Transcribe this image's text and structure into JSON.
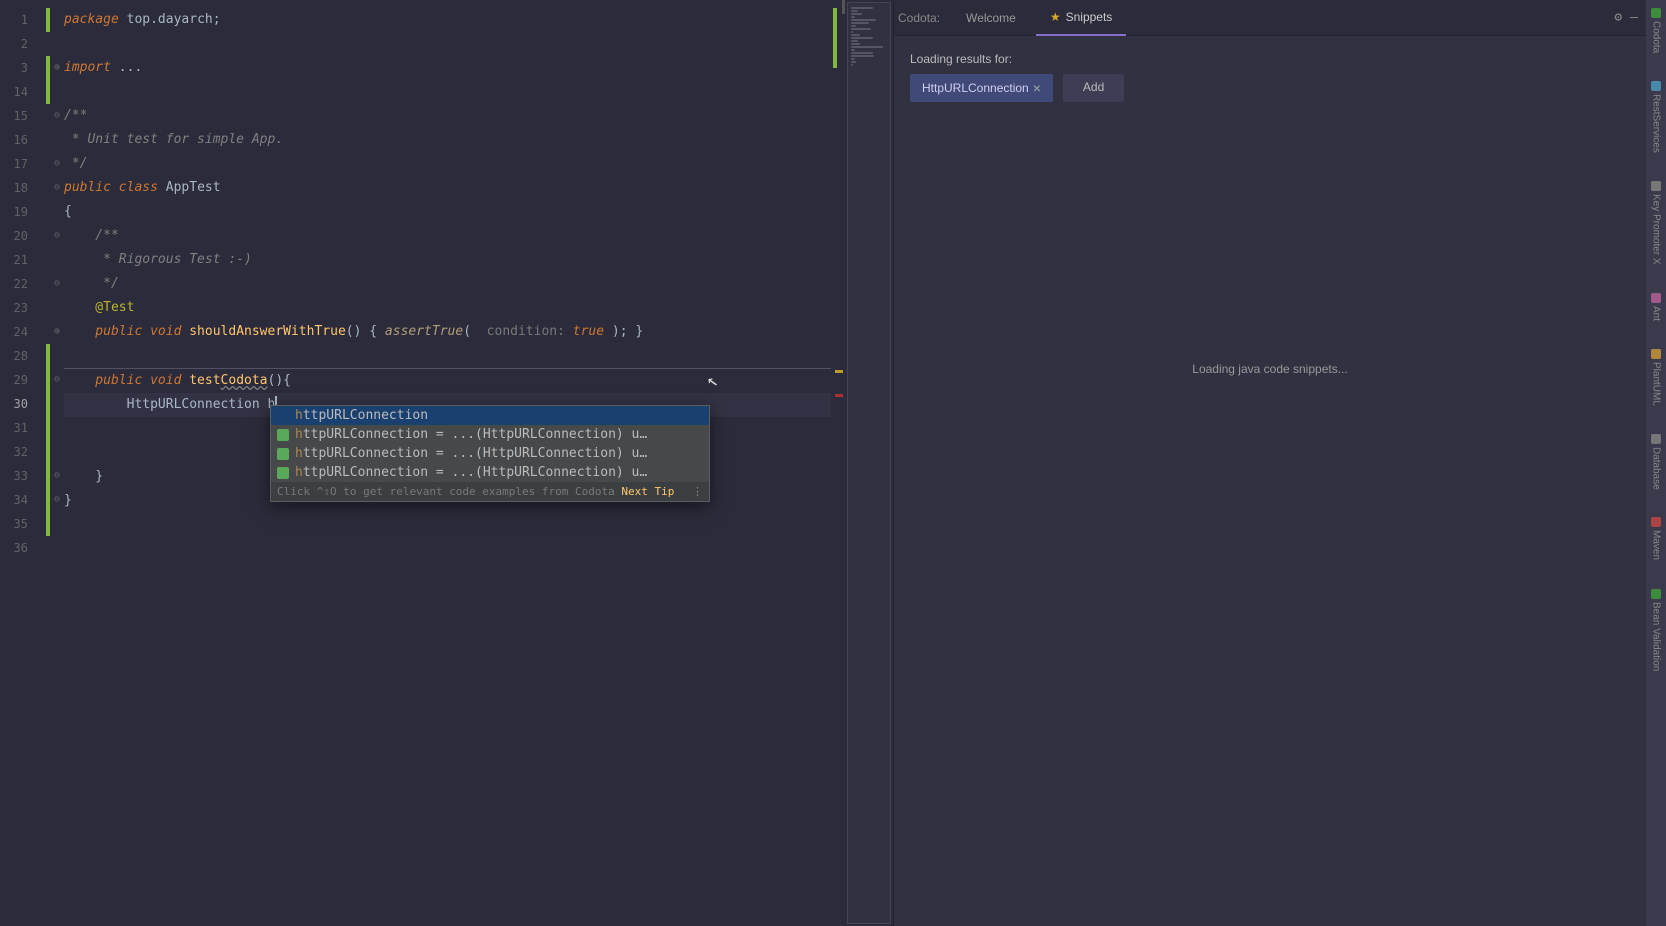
{
  "line_numbers": [
    "1",
    "2",
    "3",
    "14",
    "15",
    "16",
    "17",
    "18",
    "19",
    "20",
    "21",
    "22",
    "23",
    "24",
    "28",
    "29",
    "30",
    "31",
    "32",
    "33",
    "34",
    "35",
    "36"
  ],
  "code": {
    "l1_kw": "package",
    "l1_pkg": " top.dayarch",
    "l1_semi": ";",
    "l3_kw": "import",
    "l3_rest": " ...",
    "l15_open": "/**",
    "l16": " * Unit test for simple App.",
    "l17_close": " */",
    "l18_pub": "public ",
    "l18_class": "class ",
    "l18_name": "AppTest",
    "l19_brace": "{",
    "l20": "    /**",
    "l21": "     * Rigorous Test :-)",
    "l22": "     */",
    "l23_ann": "    @Test",
    "l24_pub": "    public ",
    "l24_void": "void ",
    "l24_mthd": "shouldAnswerWithTrue",
    "l24_paren": "() { ",
    "l24_call": "assertTrue",
    "l24_open": "( ",
    "l24_hint": " condition: ",
    "l24_true": "true",
    "l24_close": " ); }",
    "l29_pub": "    public ",
    "l29_void": "void ",
    "l29_mthd_pre": "test",
    "l29_mthd_warn": "Codota",
    "l29_rest": "(){",
    "l30_type": "        HttpURLConnection ",
    "l30_var": "h",
    "l33_close": "    }",
    "l34_close": "}"
  },
  "autocomplete": {
    "items": [
      {
        "lead": "h",
        "text": "ttpURLConnection"
      },
      {
        "lead": "h",
        "text": "ttpURLConnection = ...(HttpURLConnection) u…"
      },
      {
        "lead": "h",
        "text": "ttpURLConnection = ...(HttpURLConnection) u…"
      },
      {
        "lead": "h",
        "text": "ttpURLConnection = ...(HttpURLConnection) u…"
      }
    ],
    "footer_tip": "Click ^⇧O to get relevant code examples from Codota",
    "footer_next": "Next Tip",
    "footer_more": "⋮"
  },
  "panel": {
    "label": "Codota:",
    "tabs": {
      "welcome": "Welcome",
      "snippets": "Snippets"
    },
    "loading_for": "Loading results for:",
    "pill": "HttpURLConnection",
    "add": "Add",
    "loading_center": "Loading java code snippets..."
  },
  "right_toolbar": [
    "Codota",
    "RestServices",
    "Key Promoter X",
    "Ant",
    "PlantUML",
    "Database",
    "Maven",
    "Bean Validation"
  ]
}
